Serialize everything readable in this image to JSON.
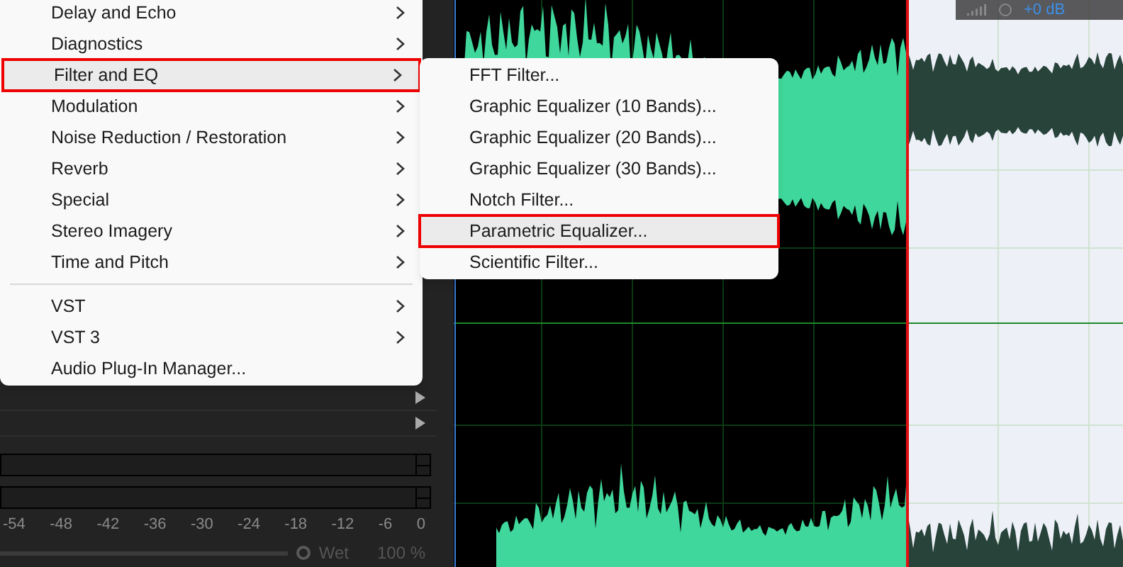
{
  "effects_menu": {
    "items": [
      {
        "kind": "submenu",
        "label": "Delay and Echo",
        "selected": false
      },
      {
        "kind": "submenu",
        "label": "Diagnostics",
        "selected": false
      },
      {
        "kind": "submenu",
        "label": "Filter and EQ",
        "selected": true
      },
      {
        "kind": "submenu",
        "label": "Modulation",
        "selected": false
      },
      {
        "kind": "submenu",
        "label": "Noise Reduction / Restoration",
        "selected": false
      },
      {
        "kind": "submenu",
        "label": "Reverb",
        "selected": false
      },
      {
        "kind": "submenu",
        "label": "Special",
        "selected": false
      },
      {
        "kind": "submenu",
        "label": "Stereo Imagery",
        "selected": false
      },
      {
        "kind": "submenu",
        "label": "Time and Pitch",
        "selected": false
      },
      {
        "kind": "separator"
      },
      {
        "kind": "submenu",
        "label": "VST",
        "selected": false
      },
      {
        "kind": "submenu",
        "label": "VST 3",
        "selected": false
      },
      {
        "kind": "item",
        "label": "Audio Plug-In Manager...",
        "selected": false
      }
    ]
  },
  "filter_submenu": {
    "items": [
      {
        "label": "FFT Filter...",
        "selected": false
      },
      {
        "label": "Graphic Equalizer (10 Bands)...",
        "selected": false
      },
      {
        "label": "Graphic Equalizer (20 Bands)...",
        "selected": false
      },
      {
        "label": "Graphic Equalizer (30 Bands)...",
        "selected": false
      },
      {
        "label": "Notch Filter...",
        "selected": false
      },
      {
        "label": "Parametric Equalizer...",
        "selected": true
      },
      {
        "label": "Scientific Filter...",
        "selected": false
      }
    ]
  },
  "meter_scale": [
    "-54",
    "-48",
    "-42",
    "-36",
    "-30",
    "-24",
    "-18",
    "-12",
    "-6",
    "0"
  ],
  "mix": {
    "label": "Wet",
    "level": 1,
    "reading": "100 %"
  },
  "hud": {
    "gain": "+0 dB"
  }
}
